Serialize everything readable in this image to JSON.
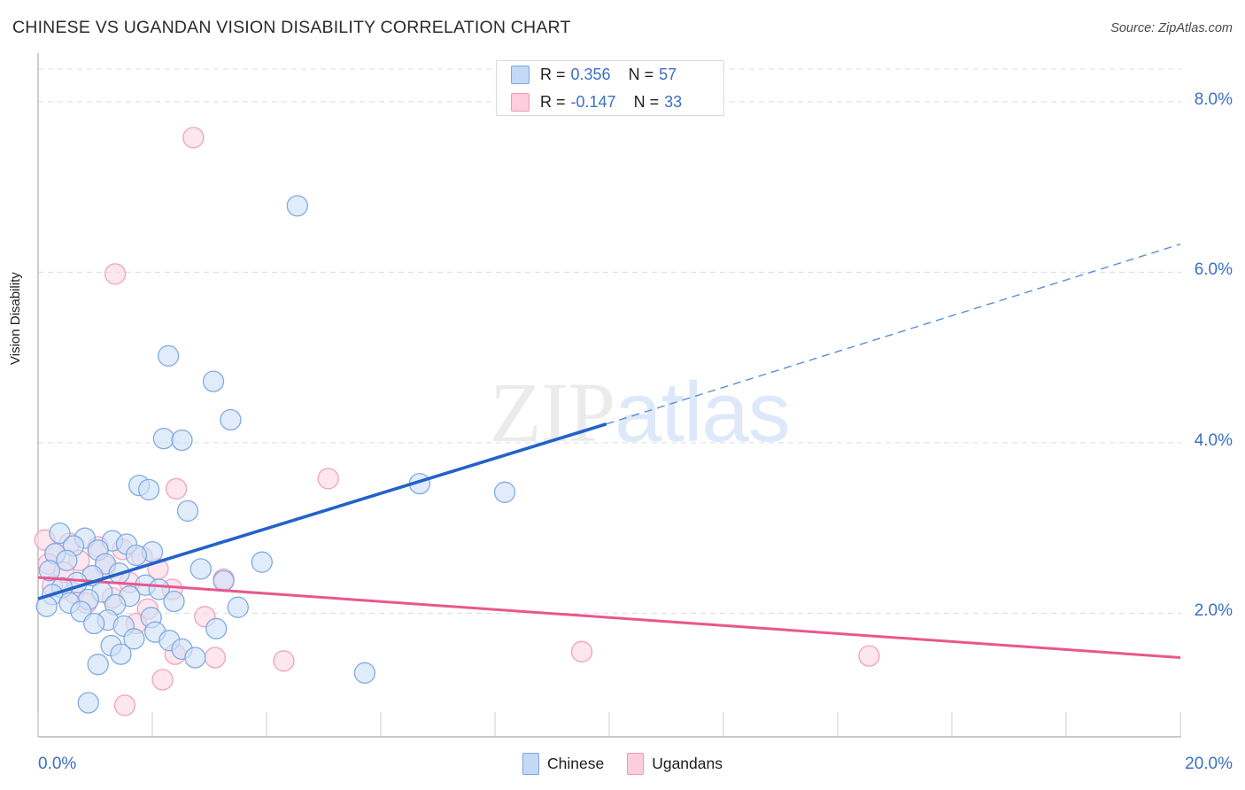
{
  "header": {
    "title": "CHINESE VS UGANDAN VISION DISABILITY CORRELATION CHART",
    "source": "Source: ZipAtlas.com"
  },
  "watermark": {
    "part1": "ZIP",
    "part2": "atlas"
  },
  "axes": {
    "y_title": "Vision Disability",
    "y_ticks": [
      "8.0%",
      "6.0%",
      "4.0%",
      "2.0%"
    ],
    "x_min_label": "0.0%",
    "x_max_label": "20.0%"
  },
  "stats_legend": {
    "rows": [
      {
        "series": "Chinese",
        "r_label": "R =",
        "r_value": "0.356",
        "n_label": "N =",
        "n_value": "57",
        "color": "#c3d9f5"
      },
      {
        "series": "Ugandans",
        "r_label": "R =",
        "r_value": "-0.147",
        "n_label": "N =",
        "n_value": "33",
        "color": "#fbcddd"
      }
    ]
  },
  "series_legend": [
    {
      "label": "Chinese",
      "color": "#c3d9f5"
    },
    {
      "label": "Ugandans",
      "color": "#fbcddd"
    }
  ],
  "colors": {
    "blue_fill": "#cfe0f7",
    "blue_stroke": "#7aa6e0",
    "pink_fill": "#fcd6e2",
    "pink_stroke": "#ef9dba",
    "blue_line": "#2163c9",
    "pink_line": "#e8578d",
    "tick_text": "#3b6fc4",
    "grid": "#dcdcdc"
  },
  "chart_data": {
    "type": "scatter",
    "title": "CHINESE VS UGANDAN VISION DISABILITY CORRELATION CHART",
    "xlabel": "",
    "ylabel": "Vision Disability",
    "xlim": [
      0.0,
      20.0
    ],
    "ylim": [
      0.55,
      8.55
    ],
    "x_tick_values": [
      0.0,
      20.0
    ],
    "y_tick_values": [
      2.0,
      4.0,
      6.0,
      8.0
    ],
    "grid": "horizontal-dashed",
    "legend_position": "bottom-center",
    "series": [
      {
        "name": "Chinese",
        "color": "#cfe0f7",
        "R": 0.356,
        "N": 57,
        "trendline": {
          "style": "solid-then-dashed",
          "x_solid": [
            0.0,
            9.95
          ],
          "y_solid": [
            2.17,
            4.22
          ],
          "x_dashed": [
            9.95,
            20.0
          ],
          "y_dashed": [
            4.22,
            6.33
          ]
        },
        "points": [
          [
            4.54,
            6.78
          ],
          [
            2.28,
            5.02
          ],
          [
            3.07,
            4.72
          ],
          [
            3.37,
            4.27
          ],
          [
            2.2,
            4.05
          ],
          [
            2.52,
            4.03
          ],
          [
            1.77,
            3.5
          ],
          [
            1.94,
            3.45
          ],
          [
            2.62,
            3.2
          ],
          [
            6.68,
            3.52
          ],
          [
            8.17,
            3.42
          ],
          [
            0.38,
            2.94
          ],
          [
            0.82,
            2.88
          ],
          [
            1.3,
            2.85
          ],
          [
            1.55,
            2.81
          ],
          [
            0.62,
            2.79
          ],
          [
            1.05,
            2.74
          ],
          [
            2.0,
            2.72
          ],
          [
            0.3,
            2.7
          ],
          [
            1.72,
            2.68
          ],
          [
            3.92,
            2.6
          ],
          [
            0.5,
            2.62
          ],
          [
            1.18,
            2.58
          ],
          [
            2.85,
            2.52
          ],
          [
            0.2,
            2.5
          ],
          [
            1.42,
            2.47
          ],
          [
            0.95,
            2.44
          ],
          [
            3.25,
            2.38
          ],
          [
            0.68,
            2.36
          ],
          [
            1.88,
            2.33
          ],
          [
            0.42,
            2.3
          ],
          [
            2.12,
            2.28
          ],
          [
            1.12,
            2.25
          ],
          [
            0.25,
            2.22
          ],
          [
            1.6,
            2.2
          ],
          [
            0.88,
            2.16
          ],
          [
            2.38,
            2.14
          ],
          [
            0.55,
            2.12
          ],
          [
            1.35,
            2.1
          ],
          [
            0.15,
            2.08
          ],
          [
            3.5,
            2.07
          ],
          [
            0.75,
            2.02
          ],
          [
            1.98,
            1.95
          ],
          [
            1.22,
            1.92
          ],
          [
            0.98,
            1.88
          ],
          [
            1.5,
            1.85
          ],
          [
            3.12,
            1.82
          ],
          [
            2.05,
            1.78
          ],
          [
            1.68,
            1.7
          ],
          [
            2.3,
            1.68
          ],
          [
            1.28,
            1.62
          ],
          [
            2.52,
            1.58
          ],
          [
            1.45,
            1.52
          ],
          [
            2.75,
            1.48
          ],
          [
            5.72,
            1.3
          ],
          [
            0.88,
            0.95
          ],
          [
            1.05,
            1.4
          ]
        ]
      },
      {
        "name": "Ugandans",
        "color": "#fcd6e2",
        "R": -0.147,
        "N": 33,
        "trendline": {
          "style": "solid",
          "x": [
            0.0,
            20.0
          ],
          "y": [
            2.42,
            1.48
          ]
        },
        "points": [
          [
            2.72,
            7.58
          ],
          [
            1.35,
            5.98
          ],
          [
            2.42,
            3.46
          ],
          [
            5.08,
            3.58
          ],
          [
            0.12,
            2.86
          ],
          [
            0.55,
            2.82
          ],
          [
            1.05,
            2.78
          ],
          [
            1.48,
            2.75
          ],
          [
            0.3,
            2.7
          ],
          [
            1.82,
            2.66
          ],
          [
            0.72,
            2.62
          ],
          [
            0.18,
            2.58
          ],
          [
            1.18,
            2.55
          ],
          [
            2.1,
            2.52
          ],
          [
            0.45,
            2.48
          ],
          [
            0.95,
            2.44
          ],
          [
            3.25,
            2.4
          ],
          [
            1.6,
            2.36
          ],
          [
            0.25,
            2.32
          ],
          [
            2.35,
            2.28
          ],
          [
            0.62,
            2.24
          ],
          [
            1.3,
            2.18
          ],
          [
            0.85,
            2.12
          ],
          [
            1.92,
            2.05
          ],
          [
            2.92,
            1.96
          ],
          [
            1.72,
            1.88
          ],
          [
            2.4,
            1.52
          ],
          [
            3.1,
            1.48
          ],
          [
            4.3,
            1.44
          ],
          [
            2.18,
            1.22
          ],
          [
            1.52,
            0.92
          ],
          [
            9.52,
            1.55
          ],
          [
            14.55,
            1.5
          ]
        ]
      }
    ]
  }
}
